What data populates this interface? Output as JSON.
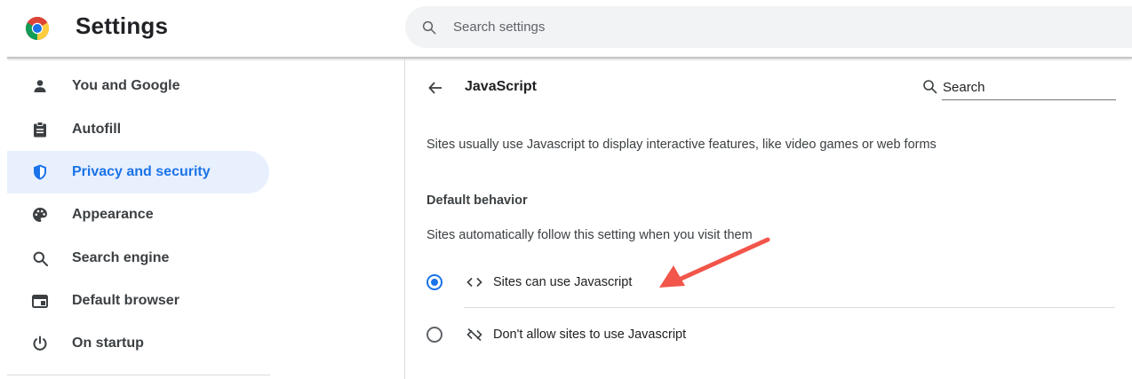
{
  "header": {
    "title": "Settings",
    "logo_icon": "chrome-logo-icon",
    "search_placeholder": "Search settings",
    "search_icon": "search-icon"
  },
  "sidebar": {
    "items": [
      {
        "label": "You and Google",
        "icon": "person-icon",
        "active": false
      },
      {
        "label": "Autofill",
        "icon": "clipboard-icon",
        "active": false
      },
      {
        "label": "Privacy and security",
        "icon": "shield-icon",
        "active": true
      },
      {
        "label": "Appearance",
        "icon": "palette-icon",
        "active": false
      },
      {
        "label": "Search engine",
        "icon": "search-icon",
        "active": false
      },
      {
        "label": "Default browser",
        "icon": "browser-icon",
        "active": false
      },
      {
        "label": "On startup",
        "icon": "power-icon",
        "active": false
      }
    ]
  },
  "main": {
    "back_icon": "back-arrow-icon",
    "title": "JavaScript",
    "search_placeholder": "Search",
    "description": "Sites usually use Javascript to display interactive features, like video games or web forms",
    "section": {
      "heading": "Default behavior",
      "subtext": "Sites automatically follow this setting when you visit them",
      "options": [
        {
          "label": "Sites can use Javascript",
          "icon": "code-icon",
          "selected": true
        },
        {
          "label": "Don't allow sites to use Javascript",
          "icon": "code-off-icon",
          "selected": false
        }
      ]
    }
  },
  "colors": {
    "accent": "#1a73e8",
    "active_background": "#e8f0fe",
    "annotation_arrow": "#f2554a"
  }
}
